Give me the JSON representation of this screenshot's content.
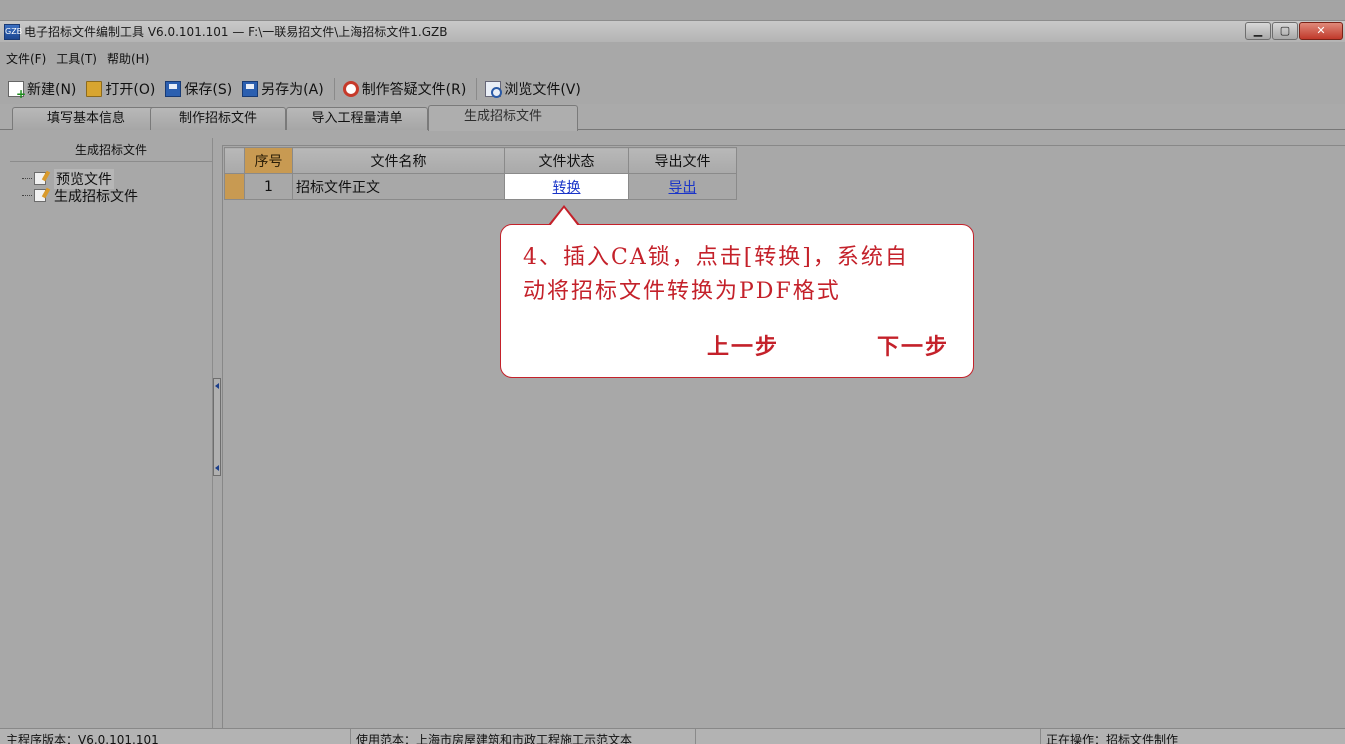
{
  "window": {
    "title": "电子招标文件编制工具 V6.0.101.101 — F:\\一联易招文件\\上海招标文件1.GZB",
    "icon_text": "GZB",
    "minimize": "▁",
    "maximize": "▢",
    "close": "✕"
  },
  "menu": [
    {
      "label": "文件(F)"
    },
    {
      "label": "工具(T)"
    },
    {
      "label": "帮助(H)"
    }
  ],
  "toolbar": {
    "new": "新建(N)",
    "open": "打开(O)",
    "save": "保存(S)",
    "save_as": "另存为(A)",
    "make_faq": "制作答疑文件(R)",
    "browse": "浏览文件(V)"
  },
  "tabs": [
    {
      "label": "填写基本信息"
    },
    {
      "label": "制作招标文件"
    },
    {
      "label": "导入工程量清单"
    },
    {
      "label": "生成招标文件"
    }
  ],
  "left_panel": {
    "header": "生成招标文件",
    "items": [
      {
        "label": "预览文件"
      },
      {
        "label": "生成招标文件"
      }
    ]
  },
  "grid": {
    "columns": [
      "序号",
      "文件名称",
      "文件状态",
      "导出文件"
    ],
    "rows": [
      {
        "seq": "1",
        "name": "招标文件正文",
        "status": "转换",
        "export": "导出"
      }
    ]
  },
  "callout": {
    "line1": "4、插入CA锁，点击[转换]，系统自",
    "line2": "动将招标文件转换为PDF格式",
    "prev": "上一步",
    "next": "下一步",
    "border_color": "#c4212a"
  },
  "status": {
    "version": "主程序版本：V6.0.101.101",
    "template": "使用范本：上海市房屋建筑和市政工程施工示范文本",
    "operation": "正在操作：招标文件制作"
  },
  "colors": {
    "accent_row_header": "#c89a52",
    "link": "#1a35c8"
  }
}
